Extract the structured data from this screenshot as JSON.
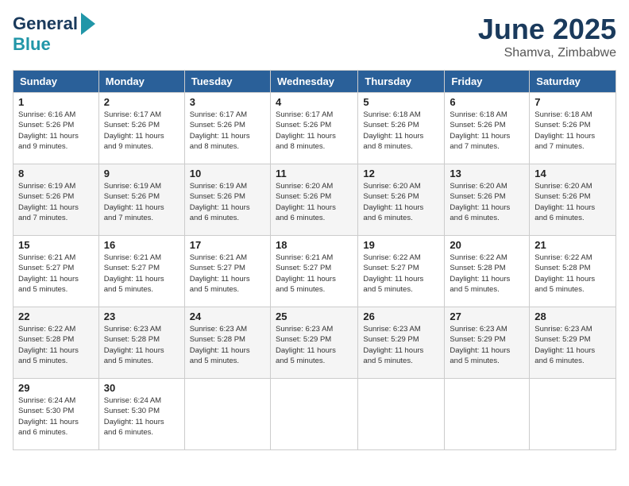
{
  "header": {
    "logo_line1": "General",
    "logo_line2": "Blue",
    "month": "June 2025",
    "location": "Shamva, Zimbabwe"
  },
  "days_of_week": [
    "Sunday",
    "Monday",
    "Tuesday",
    "Wednesday",
    "Thursday",
    "Friday",
    "Saturday"
  ],
  "weeks": [
    [
      {
        "num": "1",
        "info": "Sunrise: 6:16 AM\nSunset: 5:26 PM\nDaylight: 11 hours\nand 9 minutes."
      },
      {
        "num": "2",
        "info": "Sunrise: 6:17 AM\nSunset: 5:26 PM\nDaylight: 11 hours\nand 9 minutes."
      },
      {
        "num": "3",
        "info": "Sunrise: 6:17 AM\nSunset: 5:26 PM\nDaylight: 11 hours\nand 8 minutes."
      },
      {
        "num": "4",
        "info": "Sunrise: 6:17 AM\nSunset: 5:26 PM\nDaylight: 11 hours\nand 8 minutes."
      },
      {
        "num": "5",
        "info": "Sunrise: 6:18 AM\nSunset: 5:26 PM\nDaylight: 11 hours\nand 8 minutes."
      },
      {
        "num": "6",
        "info": "Sunrise: 6:18 AM\nSunset: 5:26 PM\nDaylight: 11 hours\nand 7 minutes."
      },
      {
        "num": "7",
        "info": "Sunrise: 6:18 AM\nSunset: 5:26 PM\nDaylight: 11 hours\nand 7 minutes."
      }
    ],
    [
      {
        "num": "8",
        "info": "Sunrise: 6:19 AM\nSunset: 5:26 PM\nDaylight: 11 hours\nand 7 minutes."
      },
      {
        "num": "9",
        "info": "Sunrise: 6:19 AM\nSunset: 5:26 PM\nDaylight: 11 hours\nand 7 minutes."
      },
      {
        "num": "10",
        "info": "Sunrise: 6:19 AM\nSunset: 5:26 PM\nDaylight: 11 hours\nand 6 minutes."
      },
      {
        "num": "11",
        "info": "Sunrise: 6:20 AM\nSunset: 5:26 PM\nDaylight: 11 hours\nand 6 minutes."
      },
      {
        "num": "12",
        "info": "Sunrise: 6:20 AM\nSunset: 5:26 PM\nDaylight: 11 hours\nand 6 minutes."
      },
      {
        "num": "13",
        "info": "Sunrise: 6:20 AM\nSunset: 5:26 PM\nDaylight: 11 hours\nand 6 minutes."
      },
      {
        "num": "14",
        "info": "Sunrise: 6:20 AM\nSunset: 5:26 PM\nDaylight: 11 hours\nand 6 minutes."
      }
    ],
    [
      {
        "num": "15",
        "info": "Sunrise: 6:21 AM\nSunset: 5:27 PM\nDaylight: 11 hours\nand 5 minutes."
      },
      {
        "num": "16",
        "info": "Sunrise: 6:21 AM\nSunset: 5:27 PM\nDaylight: 11 hours\nand 5 minutes."
      },
      {
        "num": "17",
        "info": "Sunrise: 6:21 AM\nSunset: 5:27 PM\nDaylight: 11 hours\nand 5 minutes."
      },
      {
        "num": "18",
        "info": "Sunrise: 6:21 AM\nSunset: 5:27 PM\nDaylight: 11 hours\nand 5 minutes."
      },
      {
        "num": "19",
        "info": "Sunrise: 6:22 AM\nSunset: 5:27 PM\nDaylight: 11 hours\nand 5 minutes."
      },
      {
        "num": "20",
        "info": "Sunrise: 6:22 AM\nSunset: 5:28 PM\nDaylight: 11 hours\nand 5 minutes."
      },
      {
        "num": "21",
        "info": "Sunrise: 6:22 AM\nSunset: 5:28 PM\nDaylight: 11 hours\nand 5 minutes."
      }
    ],
    [
      {
        "num": "22",
        "info": "Sunrise: 6:22 AM\nSunset: 5:28 PM\nDaylight: 11 hours\nand 5 minutes."
      },
      {
        "num": "23",
        "info": "Sunrise: 6:23 AM\nSunset: 5:28 PM\nDaylight: 11 hours\nand 5 minutes."
      },
      {
        "num": "24",
        "info": "Sunrise: 6:23 AM\nSunset: 5:28 PM\nDaylight: 11 hours\nand 5 minutes."
      },
      {
        "num": "25",
        "info": "Sunrise: 6:23 AM\nSunset: 5:29 PM\nDaylight: 11 hours\nand 5 minutes."
      },
      {
        "num": "26",
        "info": "Sunrise: 6:23 AM\nSunset: 5:29 PM\nDaylight: 11 hours\nand 5 minutes."
      },
      {
        "num": "27",
        "info": "Sunrise: 6:23 AM\nSunset: 5:29 PM\nDaylight: 11 hours\nand 5 minutes."
      },
      {
        "num": "28",
        "info": "Sunrise: 6:23 AM\nSunset: 5:29 PM\nDaylight: 11 hours\nand 6 minutes."
      }
    ],
    [
      {
        "num": "29",
        "info": "Sunrise: 6:24 AM\nSunset: 5:30 PM\nDaylight: 11 hours\nand 6 minutes."
      },
      {
        "num": "30",
        "info": "Sunrise: 6:24 AM\nSunset: 5:30 PM\nDaylight: 11 hours\nand 6 minutes."
      },
      {
        "num": "",
        "info": ""
      },
      {
        "num": "",
        "info": ""
      },
      {
        "num": "",
        "info": ""
      },
      {
        "num": "",
        "info": ""
      },
      {
        "num": "",
        "info": ""
      }
    ]
  ]
}
